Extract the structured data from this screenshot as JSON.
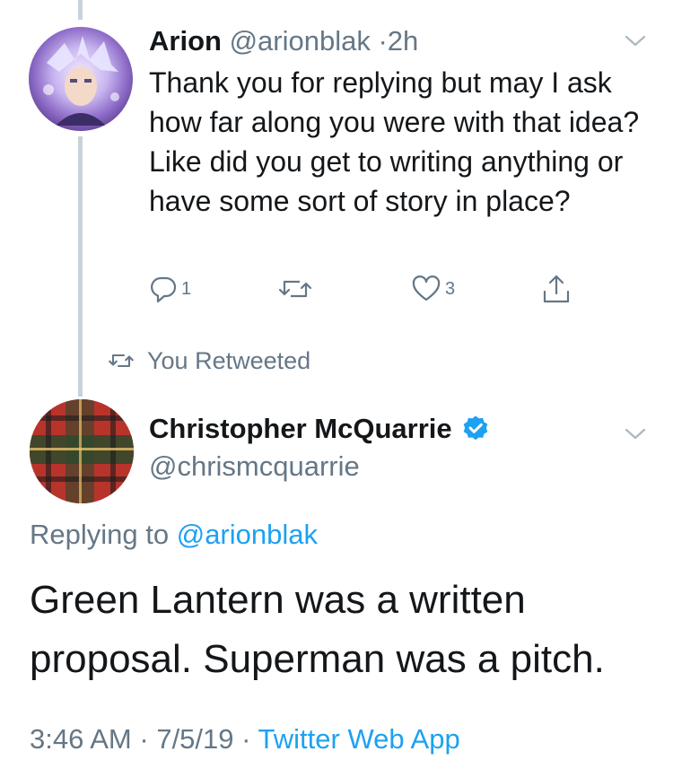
{
  "reply_tweet": {
    "author_name": "Arion",
    "author_handle": "@arionblak",
    "separator": "·",
    "time_ago": "2h",
    "text": "Thank you for replying but may I ask how far along you were with that idea? Like did you get to writing anything or have some sort of story in place?",
    "reply_count": "1",
    "like_count": "3"
  },
  "retweet_label": "You Retweeted",
  "main_tweet": {
    "author_name": "Christopher McQuarrie",
    "author_handle": "@chrismcquarrie",
    "replying_prefix": "Replying to",
    "replying_handle": "@arionblak",
    "text": "Green Lantern was a written proposal. Superman was a pitch.",
    "time": "3:46 AM",
    "date": "7/5/19",
    "source": "Twitter Web App"
  },
  "colors": {
    "accent": "#1da1f2",
    "secondary_text": "#657786",
    "thread_line": "#c8d2db"
  },
  "icons": [
    "reply-icon",
    "retweet-icon",
    "like-icon",
    "share-icon",
    "chevron-down-icon",
    "verified-badge-icon"
  ]
}
